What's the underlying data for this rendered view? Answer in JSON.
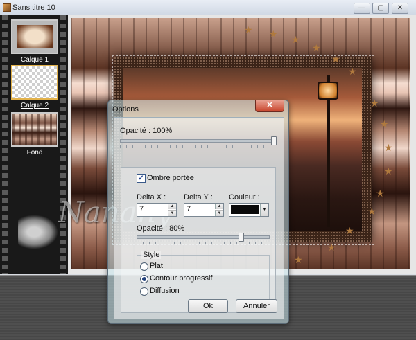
{
  "window": {
    "title": "Sans titre 10",
    "minimize_glyph": "—",
    "maximize_glyph": "▢",
    "close_glyph": "✕"
  },
  "layers": [
    {
      "name": "Calque 1",
      "selected": false
    },
    {
      "name": "Calque 2",
      "selected": true
    },
    {
      "name": "Fond",
      "selected": false
    }
  ],
  "watermark": {
    "text": "Nanany"
  },
  "dialog": {
    "title": "Options",
    "close_glyph": "✕",
    "opacity_label": "Opacité : 100%",
    "opacity_value": 100,
    "shadow_checkbox_label": "Ombre portée",
    "shadow_checked": true,
    "delta_x_label": "Delta X :",
    "delta_x_value": "7",
    "delta_y_label": "Delta Y :",
    "delta_y_value": "7",
    "color_label": "Couleur :",
    "color_value": "#0a0a0a",
    "shadow_opacity_label": "Opacité : 80%",
    "shadow_opacity_value": 80,
    "style_label": "Style",
    "style_options": [
      "Plat",
      "Contour progressif",
      "Diffusion"
    ],
    "style_selected": "Contour progressif",
    "ok_label": "Ok",
    "cancel_label": "Annuler"
  }
}
